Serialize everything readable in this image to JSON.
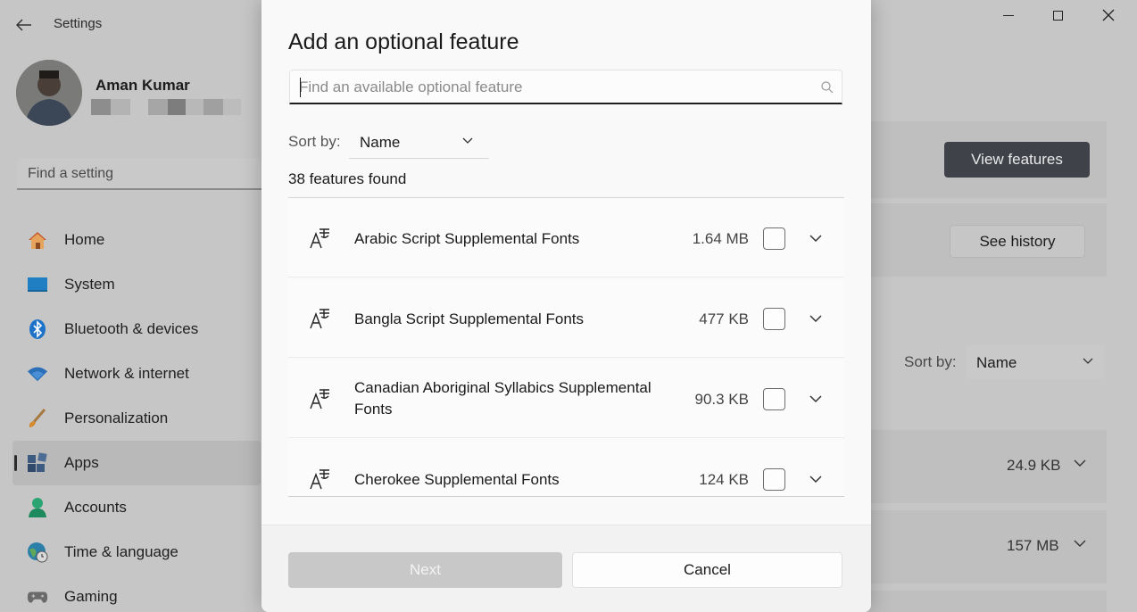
{
  "window": {
    "title": "Settings",
    "back_icon": "arrow-left-icon",
    "controls": [
      "minimize-icon",
      "maximize-icon",
      "close-icon"
    ]
  },
  "profile": {
    "name": "Aman Kumar"
  },
  "search_setting": {
    "placeholder": "Find a setting"
  },
  "nav": {
    "items": [
      {
        "label": "Home",
        "icon": "home-icon"
      },
      {
        "label": "System",
        "icon": "system-icon"
      },
      {
        "label": "Bluetooth & devices",
        "icon": "bluetooth-icon"
      },
      {
        "label": "Network & internet",
        "icon": "wifi-icon"
      },
      {
        "label": "Personalization",
        "icon": "brush-icon"
      },
      {
        "label": "Apps",
        "icon": "apps-icon",
        "active": true
      },
      {
        "label": "Accounts",
        "icon": "person-icon"
      },
      {
        "label": "Time & language",
        "icon": "globe-clock-icon"
      },
      {
        "label": "Gaming",
        "icon": "gamepad-icon"
      }
    ]
  },
  "background": {
    "view_features_label": "View features",
    "see_history_label": "See history",
    "sort_label": "Sort by:",
    "sort_value": "Name",
    "installed_sizes": [
      "24.9 KB",
      "157 MB"
    ]
  },
  "dialog": {
    "title": "Add an optional feature",
    "search_placeholder": "Find an available optional feature",
    "search_value": "",
    "sort_label": "Sort by:",
    "sort_value": "Name",
    "found_text": "38 features found",
    "features": [
      {
        "name": "Arabic Script Supplemental Fonts",
        "size": "1.64 MB",
        "checked": false,
        "icon": "font-icon"
      },
      {
        "name": "Bangla Script Supplemental Fonts",
        "size": "477 KB",
        "checked": false,
        "icon": "font-icon"
      },
      {
        "name": "Canadian Aboriginal Syllabics Supplemental Fonts",
        "size": "90.3 KB",
        "checked": false,
        "icon": "font-icon"
      },
      {
        "name": "Cherokee Supplemental Fonts",
        "size": "124 KB",
        "checked": false,
        "icon": "font-icon"
      }
    ],
    "next_label": "Next",
    "next_enabled": false,
    "cancel_label": "Cancel"
  },
  "colors": {
    "accent_button": "#3f4349",
    "dialog_bg": "#f9f9f9",
    "dimmed_bg": "#c6c6c6"
  }
}
